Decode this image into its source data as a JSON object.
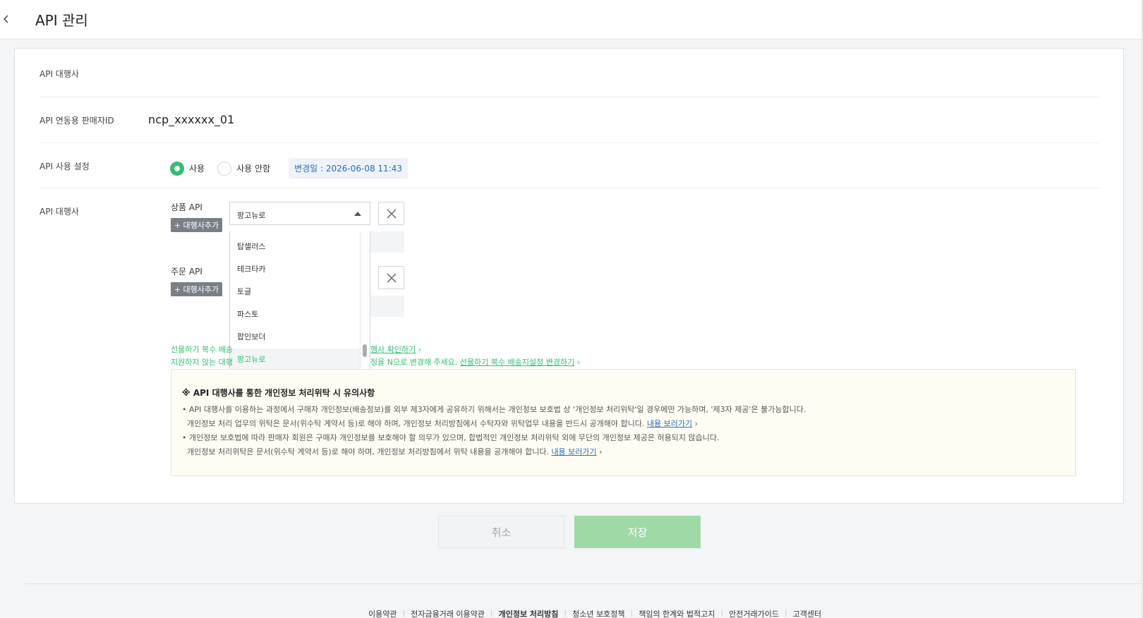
{
  "header": {
    "title": "API 관리",
    "back_icon": "chevron-left-icon"
  },
  "rows": {
    "agency_header_label": "API 대행사",
    "seller_id_label": "API 연동용 판매자ID",
    "seller_id_value": "ncp_xxxxxx_01",
    "usage_label": "API 사용 설정",
    "usage_options": [
      "사용",
      "사용 안함"
    ],
    "usage_selected": "사용",
    "changed_at": "변경일 : 2026-06-08 11:43",
    "agency_label": "API 대행사"
  },
  "product_api": {
    "label": "상품 API",
    "add_button": "+ 대행사추가",
    "selected": "팡고뉴로",
    "options": [
      "탑셀러스",
      "테크타카",
      "토글",
      "파스토",
      "팝인보더",
      "팡고뉴로"
    ]
  },
  "order_api": {
    "label": "주문 API",
    "add_button": "+ 대행사추가"
  },
  "notes": {
    "line1_prefix": "선물하기 복수 배송",
    "line1_link": "행사 확인하기",
    "line2_prefix": "지원하지 않는 대행",
    "line2_mid": "정을 N으로 변경해 주세요.",
    "line2_link": "선물하기 복수 배송지설정 변경하기"
  },
  "notice": {
    "title": "※ API 대행사를 통한 개인정보 처리위탁 시 유의사항",
    "p1": "• API 대행사를 이용하는 과정에서 구매자 개인정보(배송정보)를 외부 제3자에게 공유하기 위해서는 개인정보 보호법 상 '개인정보 처리위탁'일 경우에만 가능하며, '제3자 제공'은 불가능합니다.",
    "p2": "개인정보 처리 업무의 위탁은 문서(위수탁 계약서 등)로 해야 하며, 개인정보 처리방침에서 수탁자와 위탁업무 내용을 반드시 공개해야 합니다.",
    "p2_link": "내용 보러가기",
    "p3": "• 개인정보 보호법에 따라 판매자 회원은 구매자 개인정보를 보호해야 할 의무가 있으며, 합법적인 개인정보 처리위탁 외에 무단의 개인정보 제공은 허용되지 않습니다.",
    "p4": "개인정보 처리위탁은 문서(위수탁 계약서 등)로 해야 하며, 개인정보 처리방침에서 위탁 내용을 공개해야 합니다.",
    "p4_link": "내용 보러가기"
  },
  "buttons": {
    "cancel": "취소",
    "save": "저장"
  },
  "footer": [
    "이용약관",
    "전자금융거래 이용약관",
    "개인정보 처리방침",
    "청소년 보호정책",
    "책임의 한계와 법적고지",
    "안전거래가이드",
    "고객센터"
  ],
  "colors": {
    "accent": "#2fbf71",
    "link": "#2b6cb8",
    "save_disabled": "#9ed9a6"
  }
}
